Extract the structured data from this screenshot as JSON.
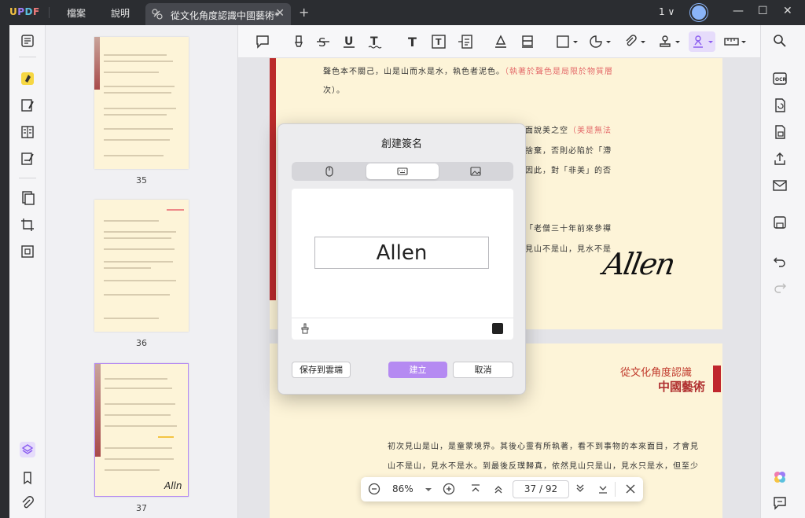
{
  "titlebar": {
    "logo": "UPDF",
    "menus": [
      "檔案",
      "說明"
    ],
    "tab_title": "從文化角度認識中國藝術*",
    "page_indicator": "1",
    "avatar_letter": "告"
  },
  "thumbnails": [
    {
      "label": "35"
    },
    {
      "label": "36"
    },
    {
      "label": "37"
    }
  ],
  "page_top": {
    "lines": [
      {
        "text": "聲色本不關己，山是山而水是水，執色者泥色。",
        "red": "（執著於聲色是局限於物質層"
      },
      {
        "text": "次）。"
      },
      {
        "text": "面說美之空",
        "red": "（美是無法"
      },
      {
        "text": "捨棄，否則必陷於「滯"
      },
      {
        "text": "因此，對「非美」的否"
      },
      {
        "text": "「老僧三十年前來參禪"
      },
      {
        "text": "見山不是山，見水不是"
      }
    ],
    "signature": "Allen"
  },
  "page_bottom": {
    "header_line1": "從文化角度認識",
    "header_line2": "中國藝術",
    "lines": [
      "初次見山是山，是童蒙境界。其後心靈有所執著，看不到事物的本來面目，才會見",
      "山不是山，見水不是水。到最後反璞歸真，依然見山只是山，見水只是水，但至少"
    ]
  },
  "dialog": {
    "title": "創建簽名",
    "signature_value": "Allen",
    "save_cloud_label": "保存到雲端",
    "create_label": "建立",
    "cancel_label": "取消"
  },
  "bottom_nav": {
    "zoom": "86%",
    "page": "37 / 92"
  },
  "colors": {
    "accent": "#b58af2",
    "page_bg": "#fdf4d8",
    "header_red": "#c0262d"
  }
}
